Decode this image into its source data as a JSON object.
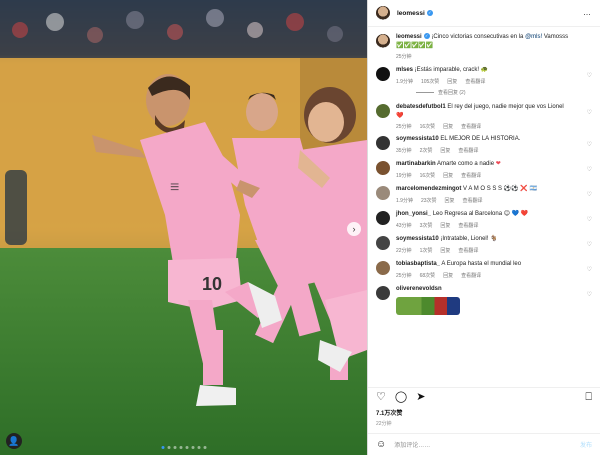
{
  "post": {
    "username": "leomessi",
    "more_icon": "…"
  },
  "caption": {
    "username": "leomessi",
    "text": "¡Cinco victorias consecutivas en la",
    "mention": "@mls!",
    "text_after": "Vamosss",
    "emojis": "✅✅✅✅✅",
    "time": "25分钟"
  },
  "comments": [
    {
      "user": "mlses",
      "text": "¡Estás imparable, crack! 🐢",
      "time": "1.9分钟",
      "likes": "105次赞",
      "reply": "回复",
      "translate": "查看翻译",
      "view_replies": "查看回复 (2)",
      "heart": "♡"
    },
    {
      "user": "debatesdefutbol1",
      "text": "El rey del juego, nadie mejor que vos Lionel",
      "text2": "❤️",
      "time": "25分钟",
      "likes": "16次赞",
      "reply": "回复",
      "translate": "查看翻译",
      "heart": "♡"
    },
    {
      "user": "soymessista10",
      "text": "EL MEJOR DE LA HISTORIA.",
      "time": "35分钟",
      "likes": "2次赞",
      "reply": "回复",
      "translate": "查看翻译",
      "heart": "♡"
    },
    {
      "user": "martinabarkin",
      "text": "Amarte como a nadie",
      "text_heart": "❤",
      "time": "19分钟",
      "likes": "16次赞",
      "reply": "回复",
      "translate": "查看翻译",
      "heart": "♡"
    },
    {
      "user": "marcelomendezmingot",
      "text": "V A M O S S S ⚽⚽ ❌ 🇦🇷",
      "time": "1.9分钟",
      "likes": "23次赞",
      "reply": "回复",
      "translate": "查看翻译",
      "heart": "♡"
    },
    {
      "user": "jhon_yonsi_",
      "text": "Leo Regresa al Barcelona 😊 💙 ❤️",
      "time": "43分钟",
      "likes": "3次赞",
      "reply": "回复",
      "translate": "查看翻译",
      "heart": "♡"
    },
    {
      "user": "soymessista10",
      "text": "¡Intratable, Lionel! 🐐",
      "time": "22分钟",
      "likes": "1次赞",
      "reply": "回复",
      "translate": "查看翻译",
      "heart": "♡"
    },
    {
      "user": "tobiasbaptista_",
      "text": "A Europa hasta el mundial leo",
      "time": "25分钟",
      "likes": "68次赞",
      "reply": "回复",
      "translate": "查看翻译",
      "heart": "♡"
    },
    {
      "user": "oliverenevoldsn",
      "text": "",
      "time": "",
      "likes": "",
      "reply": "",
      "translate": "",
      "heart": "♡"
    }
  ],
  "actions": {
    "like_icon": "♡",
    "comment_icon": "◯",
    "share_icon": "➤",
    "save_icon": "⎕"
  },
  "likes_count": "7.1万次赞",
  "post_date": "22分钟",
  "add_comment": {
    "emoji_icon": "☺",
    "placeholder": "添加评论……",
    "post_label": "发布"
  },
  "colors": {
    "accent": "#3897f0",
    "heart_red": "#ed4956",
    "jersey_pink": "#f4a8c8"
  },
  "icons": {
    "next": "›",
    "tag": "👤"
  }
}
